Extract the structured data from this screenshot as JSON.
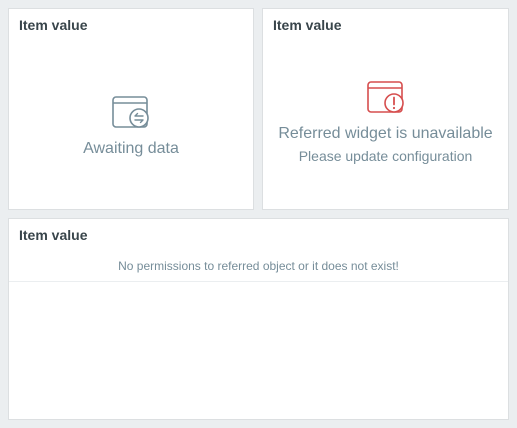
{
  "widgets": [
    {
      "title": "Item value",
      "state_text": "Awaiting data",
      "icon": "awaiting-data-icon"
    },
    {
      "title": "Item value",
      "state_text": "Referred widget is unavailable",
      "state_subtext": "Please update configuration",
      "icon": "widget-unavailable-icon"
    },
    {
      "title": "Item value",
      "message": "No permissions to referred object or it does not exist!"
    }
  ],
  "colors": {
    "page_bg": "#ebeef0",
    "widget_bg": "#ffffff",
    "title_text": "#39454b",
    "muted_text": "#768d99",
    "error_icon": "#d64e4e"
  }
}
